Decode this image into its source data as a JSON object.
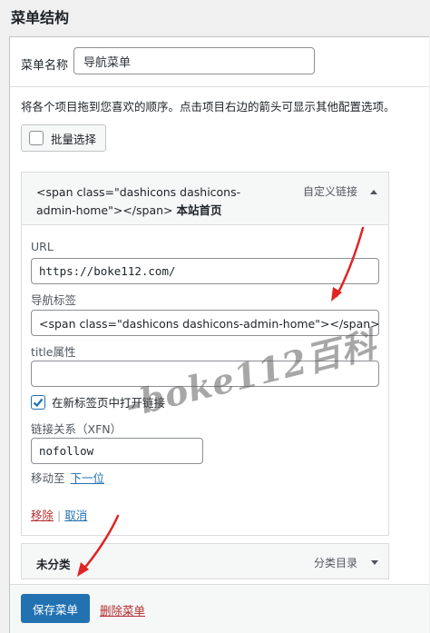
{
  "page": {
    "heading": "菜单结构"
  },
  "menu_name": {
    "label": "菜单名称",
    "value": "导航菜单"
  },
  "instructions": "将各个项目拖到您喜欢的顺序。点击项目右边的箭头可显示其他配置选项。",
  "bulk_select": {
    "label": "批量选择",
    "checked": false
  },
  "menu_item": {
    "title_line1": "<span class=\"dashicons dashicons-",
    "title_line2": "admin-home\"></span>",
    "title_name": "本站首页",
    "type": "自定义链接",
    "url_label": "URL",
    "url_value": "https://boke112.com/",
    "nav_label_label": "导航标签",
    "nav_label_value": "<span class=\"dashicons dashicons-admin-home\"></span> 本站首页",
    "title_attr_label": "title属性",
    "title_attr_value": "",
    "new_tab_label": "在新标签页中打开链接",
    "new_tab_checked": true,
    "rel_label": "链接关系（XFN）",
    "rel_value": "nofollow",
    "move_label": "移动至",
    "move_link": "下一位",
    "remove_link": "移除",
    "separator": "|",
    "cancel_link": "取消"
  },
  "uncategorized": {
    "title": "未分类",
    "type": "分类目录"
  },
  "footer": {
    "save_label": "保存菜单",
    "delete_label": "删除菜单"
  },
  "watermark": "-boke112百科",
  "colors": {
    "primary": "#2271b1",
    "danger": "#b32d2e",
    "border": "#dcdcde",
    "annotation": "#e02424"
  },
  "icons": {
    "toggle_up": "triangle-up-icon",
    "toggle_down": "triangle-down-icon",
    "check": "checkmark-icon"
  }
}
